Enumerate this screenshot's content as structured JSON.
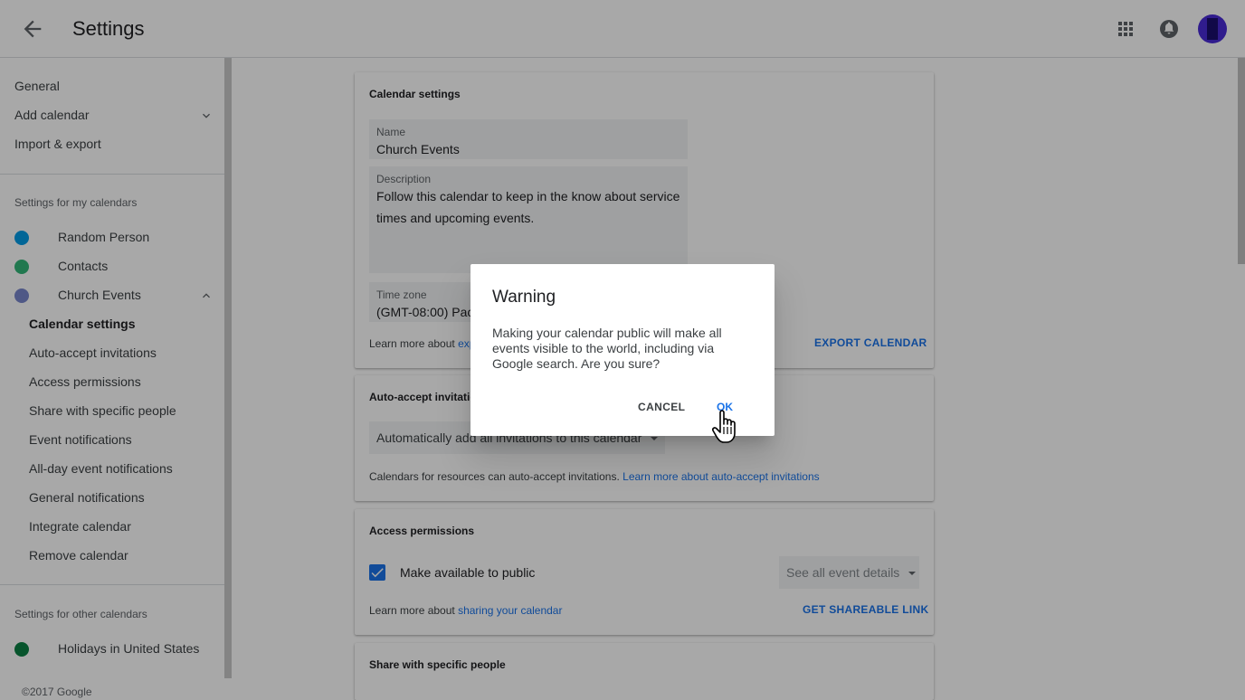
{
  "header": {
    "title": "Settings",
    "icons": {
      "back": "arrow-back-icon",
      "apps": "apps-grid-icon",
      "notifications": "notifications-icon"
    }
  },
  "sidebar": {
    "top_items": [
      "General",
      "Add calendar",
      "Import & export"
    ],
    "my_calendars_heading": "Settings for my calendars",
    "my_calendars": [
      {
        "name": "Random Person",
        "color": "#039be5"
      },
      {
        "name": "Contacts",
        "color": "#33b679"
      },
      {
        "name": "Church Events",
        "color": "#7986cb"
      }
    ],
    "church_sub_items": [
      "Calendar settings",
      "Auto-accept invitations",
      "Access permissions",
      "Share with specific people",
      "Event notifications",
      "All-day event notifications",
      "General notifications",
      "Integrate calendar",
      "Remove calendar"
    ],
    "other_calendars_heading": "Settings for other calendars",
    "other_calendars": [
      {
        "name": "Holidays in United States",
        "color": "#0b8043"
      }
    ],
    "footer": "©2017 Google"
  },
  "calendar_settings": {
    "title": "Calendar settings",
    "name_label": "Name",
    "name_value": "Church Events",
    "description_label": "Description",
    "description_line1": "Follow this calendar to keep in the know about service",
    "description_line2": "times and upcoming events.",
    "timezone_label": "Time zone",
    "timezone_value": "(GMT-08:00) Pac",
    "learn_prefix": "Learn more about",
    "learn_link": "exp",
    "export_button": "EXPORT CALENDAR"
  },
  "auto_accept": {
    "title": "Auto-accept invitatio",
    "dropdown_value": "Automatically add all invitations to this calendar",
    "note": "Calendars for resources can auto-accept invitations.",
    "note_link": "Learn more about auto-accept invitations"
  },
  "access_permissions": {
    "title": "Access permissions",
    "public_label": "Make available to public",
    "public_checked": true,
    "detail_dropdown": "See all event details",
    "learn_prefix": "Learn more about",
    "learn_link": "sharing your calendar",
    "shareable_button": "GET SHAREABLE LINK"
  },
  "share_specific": {
    "title": "Share with specific people"
  },
  "dialog": {
    "title": "Warning",
    "message": "Making your calendar public will make all events visible to the world, including via Google search. Are you sure?",
    "cancel": "CANCEL",
    "ok": "OK"
  }
}
